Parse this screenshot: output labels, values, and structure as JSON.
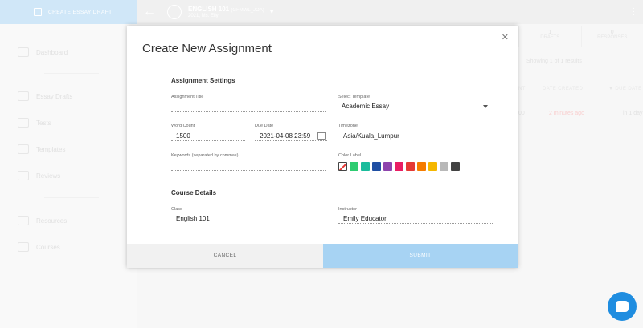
{
  "sidebar": {
    "create_button": "CREATE ESSAY DRAFT",
    "items": [
      {
        "label": "Dashboard",
        "icon": "home-icon"
      },
      {
        "label": "Essay Drafts",
        "icon": "document-icon"
      },
      {
        "label": "Tests",
        "icon": "tests-icon"
      },
      {
        "label": "Templates",
        "icon": "template-icon"
      },
      {
        "label": "Reviews",
        "icon": "review-icon"
      },
      {
        "label": "Resources",
        "icon": "books-icon"
      },
      {
        "label": "Courses",
        "icon": "book-open-icon"
      }
    ]
  },
  "topbar": {
    "course_title": "ENGLISH 101",
    "course_code": "(GFMWL_JOA)",
    "course_sub": "2021, Ms. Elly"
  },
  "background": {
    "stat1_num": "1",
    "stat1_label": "DRAFTS",
    "stat2_num": "0",
    "stat2_label": "RESPONSES",
    "showing": "Showing 1 of 1 results",
    "col_due_sort": "NT",
    "col_created": "DATE CREATED",
    "col_due": "▼ DUE DATE",
    "row_val1": "00",
    "row_created": "2 minutes ago",
    "row_due": "in 1 day"
  },
  "modal": {
    "title": "Create New Assignment",
    "settings_head": "Assignment Settings",
    "assignment_title_label": "Assignment Title",
    "assignment_title_value": "",
    "template_label": "Select Template",
    "template_value": "Academic Essay",
    "word_count_label": "Word Count",
    "word_count_value": "1500",
    "due_date_label": "Due Date",
    "due_date_value": "2021-04-08 23:59",
    "timezone_label": "Timezone",
    "timezone_value": "Asia/Kuala_Lumpur",
    "keywords_label": "Keywords (separated by commas)",
    "keywords_value": "",
    "color_label": "Color Label",
    "colors": [
      "#2ecc71",
      "#1abc9c",
      "#1f4fa3",
      "#8e44ad",
      "#e91e63",
      "#e53935",
      "#f57c00",
      "#f5b700",
      "#b8b8b8",
      "#424242"
    ],
    "course_head": "Course Details",
    "class_label": "Class",
    "class_value": "English 101",
    "instructor_label": "Instructor",
    "instructor_value": "Emily  Educator",
    "cancel": "CANCEL",
    "submit": "SUBMIT"
  }
}
